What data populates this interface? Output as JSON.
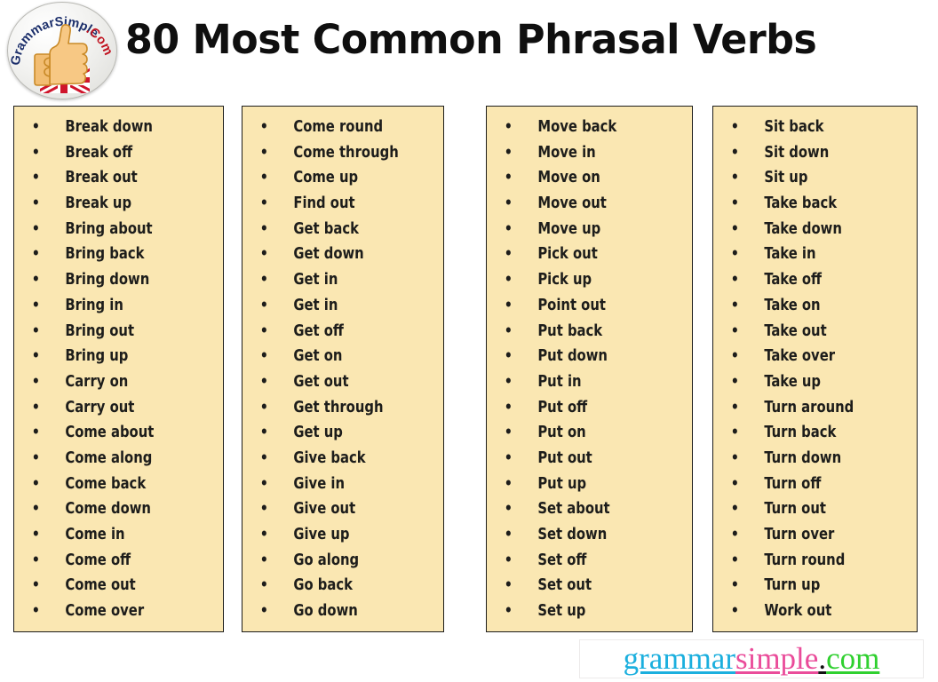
{
  "header": {
    "title": "80 Most Common Phrasal Verbs",
    "logo": {
      "name": "grammarsimple-logo",
      "arc_text_primary": "GrammarSimple",
      "arc_text_suffix": ".Com",
      "icons": [
        "thumbs-up-icon",
        "union-jack-flag-icon"
      ],
      "primary_color": "#1c2f6b",
      "suffix_color": "#c1121f"
    }
  },
  "columns": [
    {
      "name": "column-1",
      "items": [
        "Break down",
        "Break off",
        "Break out",
        "Break up",
        "Bring about",
        "Bring back",
        "Bring down",
        "Bring in",
        "Bring out",
        "Bring up",
        "Carry on",
        "Carry out",
        "Come about",
        "Come along",
        "Come back",
        "Come down",
        "Come in",
        "Come off",
        "Come out",
        "Come over"
      ]
    },
    {
      "name": "column-2",
      "items": [
        "Come round",
        "Come through",
        "Come up",
        "Find out",
        "Get back",
        "Get down",
        "Get in",
        "Get in",
        "Get off",
        "Get on",
        "Get out",
        "Get through",
        "Get up",
        "Give back",
        "Give in",
        "Give out",
        "Give up",
        "Go along",
        "Go back",
        "Go down"
      ]
    },
    {
      "name": "column-3",
      "items": [
        "Move back",
        "Move in",
        "Move on",
        "Move out",
        "Move up",
        "Pick out",
        "Pick up",
        "Point out",
        "Put back",
        "Put down",
        "Put in",
        "Put off",
        "Put on",
        "Put out",
        "Put up",
        "Set about",
        "Set down",
        "Set off",
        "Set out",
        "Set up"
      ]
    },
    {
      "name": "column-4",
      "items": [
        "Sit back",
        "Sit down",
        "Sit up",
        "Take back",
        "Take down",
        "Take in",
        "Take off",
        "Take on",
        "Take out",
        "Take over",
        "Take up",
        "Turn around",
        "Turn back",
        "Turn down",
        "Turn off",
        "Turn out",
        "Turn over",
        "Turn round",
        "Turn up",
        "Work out"
      ]
    }
  ],
  "footer": {
    "brand_segments": [
      {
        "text": "grammar",
        "color": "#1bafde"
      },
      {
        "text": "simple",
        "color": "#ea4c9a"
      },
      {
        "text": ".",
        "color": "#111111"
      },
      {
        "text": "com",
        "color": "#2fd02f"
      }
    ],
    "brand_full": "grammarsimple.com"
  },
  "theme": {
    "panel_fill": "#fae7b2",
    "panel_border": "#1d1d1b",
    "text_color": "#1d1d1b",
    "page_background": "#ffffff"
  }
}
